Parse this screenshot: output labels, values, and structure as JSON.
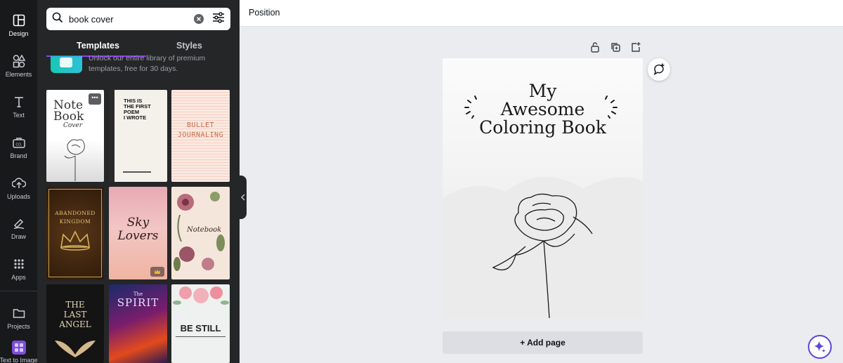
{
  "rail": [
    {
      "label": "Design",
      "icon": "design-icon",
      "active": true
    },
    {
      "label": "Elements",
      "icon": "elements-icon"
    },
    {
      "label": "Text",
      "icon": "text-icon"
    },
    {
      "label": "Brand",
      "icon": "brand-icon"
    },
    {
      "label": "Uploads",
      "icon": "uploads-icon"
    },
    {
      "label": "Draw",
      "icon": "draw-icon"
    },
    {
      "label": "Apps",
      "icon": "apps-icon"
    },
    {
      "label": "Projects",
      "icon": "projects-icon"
    },
    {
      "label": "Text to Image",
      "icon": "text-to-image-icon"
    }
  ],
  "search": {
    "value": "book cover"
  },
  "tabs": {
    "templates": "Templates",
    "styles": "Styles"
  },
  "promo": {
    "line1": "Unlock our entire library of premium",
    "line2": "templates, free for 30 days."
  },
  "templates": {
    "notebook": {
      "l1": "Note",
      "l2": "Book",
      "l3": "Cover"
    },
    "poem": {
      "l1": "THIS IS",
      "l2": "THE FIRST",
      "l3": "POEM",
      "l4": "I WROTE"
    },
    "bullet": {
      "l1": "BULLET",
      "l2": "JOURNALING"
    },
    "kingdom": {
      "l1": "ABANDONED",
      "l2": "KINGDOM"
    },
    "sky": {
      "l1": "Sky",
      "l2": "Lovers"
    },
    "notebook2": {
      "l1": "Notebook"
    },
    "angel": {
      "l1": "THE",
      "l2": "LAST",
      "l3": "ANGEL"
    },
    "spirit": {
      "l1": "The",
      "l2": "SPIRIT"
    },
    "still": {
      "l1": "BE STILL"
    }
  },
  "topbar": {
    "position": "Position"
  },
  "page": {
    "title_l1": "My",
    "title_l2": "Awesome",
    "title_l3": "Coloring Book"
  },
  "add_page": "+ Add page",
  "colors": {
    "accent": "#8b3dff",
    "rail_bg": "#18191b",
    "panel_bg": "#252627",
    "canvas_bg": "#ebecf0"
  }
}
